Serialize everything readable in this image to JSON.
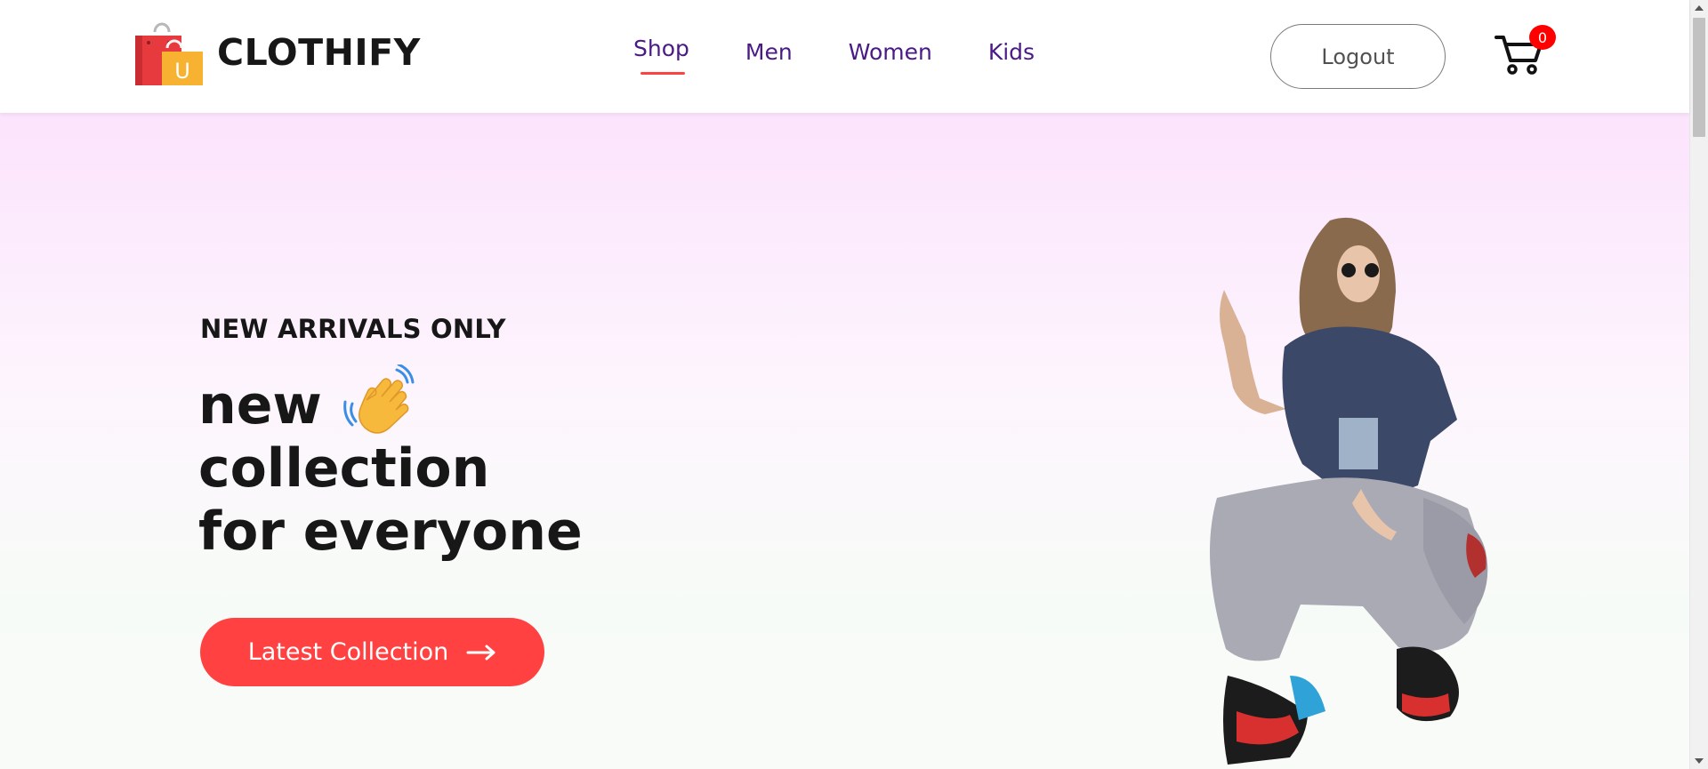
{
  "header": {
    "brand": "CLOTHIFY",
    "logo_icon": "shopping-bags-icon",
    "nav": [
      {
        "label": "Shop",
        "active": true
      },
      {
        "label": "Men",
        "active": false
      },
      {
        "label": "Women",
        "active": false
      },
      {
        "label": "Kids",
        "active": false
      }
    ],
    "logout_label": "Logout",
    "cart_icon": "cart-icon",
    "cart_count": "0"
  },
  "hero": {
    "eyebrow": "NEW ARRIVALS ONLY",
    "headline_line1": "new",
    "headline_line2": "collection",
    "headline_line3": "for everyone",
    "wave_icon": "waving-hand-icon",
    "cta_label": "Latest Collection",
    "cta_icon": "arrow-right-icon",
    "image": "model-photo"
  },
  "colors": {
    "accent": "#ff4141",
    "nav_text": "#4a1a86",
    "heading": "#171717",
    "badge": "#ff0000"
  }
}
